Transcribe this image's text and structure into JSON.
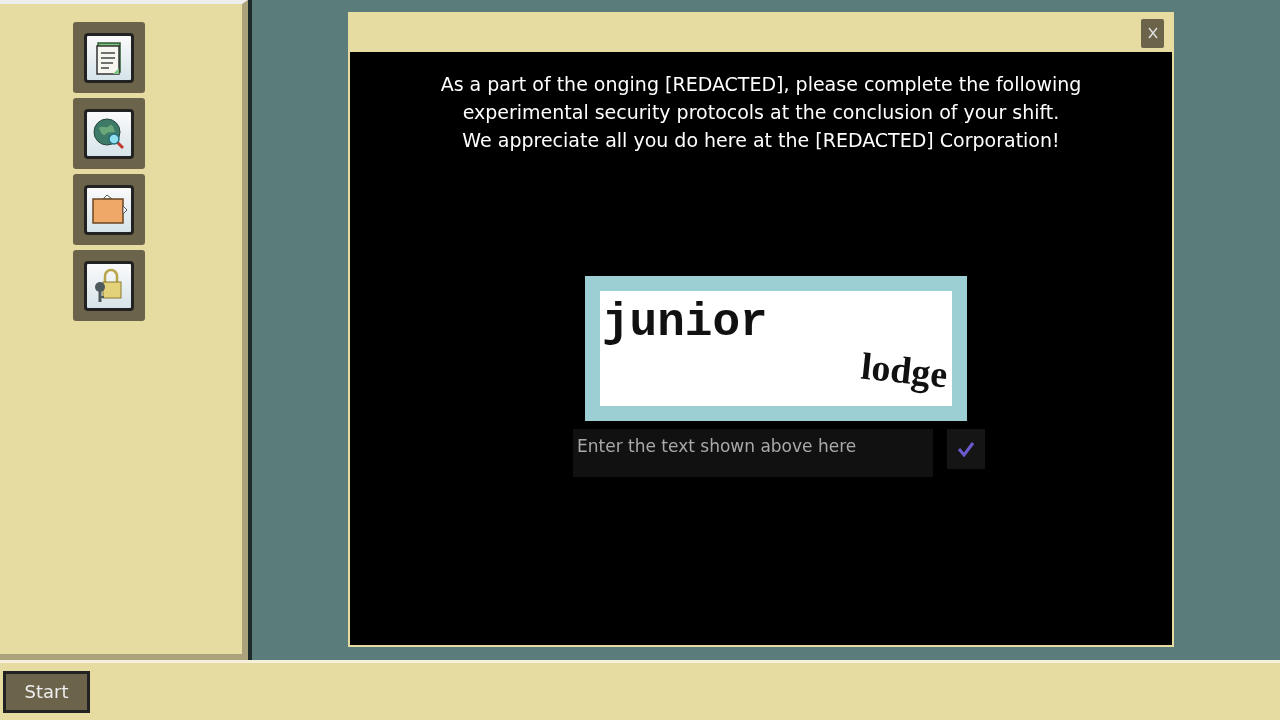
{
  "desktop_icons": [
    {
      "kind": "document"
    },
    {
      "kind": "globe-search"
    },
    {
      "kind": "folder"
    },
    {
      "kind": "lock-key"
    }
  ],
  "dialog": {
    "message_lines": [
      "As a part of the onging [REDACTED], please complete the following experimental security protocols at the conclusion of your shift.",
      "We appreciate all you do here at the [REDACTED] Corporation!"
    ],
    "captcha": {
      "words": [
        "junior",
        "lodge"
      ]
    },
    "input": {
      "placeholder": "Enter the text shown above here"
    }
  },
  "taskbar": {
    "start_label": "Start"
  }
}
